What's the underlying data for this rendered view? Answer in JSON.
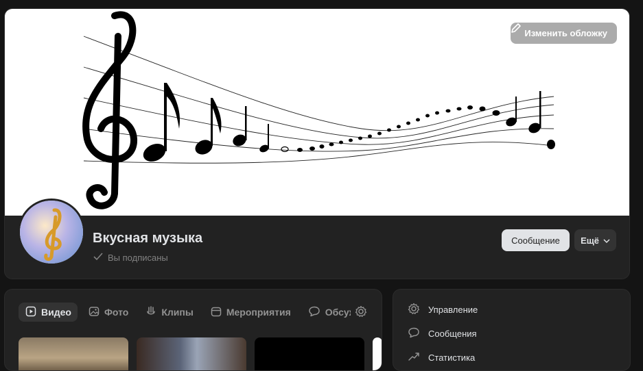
{
  "cover": {
    "change_label": "Изменить обложку"
  },
  "group": {
    "name": "Вкусная музыка",
    "status": "Вы подписаны"
  },
  "actions": {
    "message_label": "Сообщение",
    "more_label": "Ещё"
  },
  "tabs": [
    {
      "label": "Видео",
      "icon": "video-icon",
      "active": true
    },
    {
      "label": "Фото",
      "icon": "photo-icon"
    },
    {
      "label": "Клипы",
      "icon": "clips-icon"
    },
    {
      "label": "Мероприятия",
      "icon": "calendar-icon"
    },
    {
      "label": "Обсуж",
      "icon": "chat-bubble-icon"
    }
  ],
  "side_menu": [
    {
      "label": "Управление",
      "icon": "gear-icon"
    },
    {
      "label": "Сообщения",
      "icon": "chat-bubble-icon"
    },
    {
      "label": "Статистика",
      "icon": "chart-icon"
    }
  ],
  "colors": {
    "background": "#141414",
    "card": "#222222",
    "accent_button": "#e1e3e6",
    "muted_text": "#828282"
  }
}
